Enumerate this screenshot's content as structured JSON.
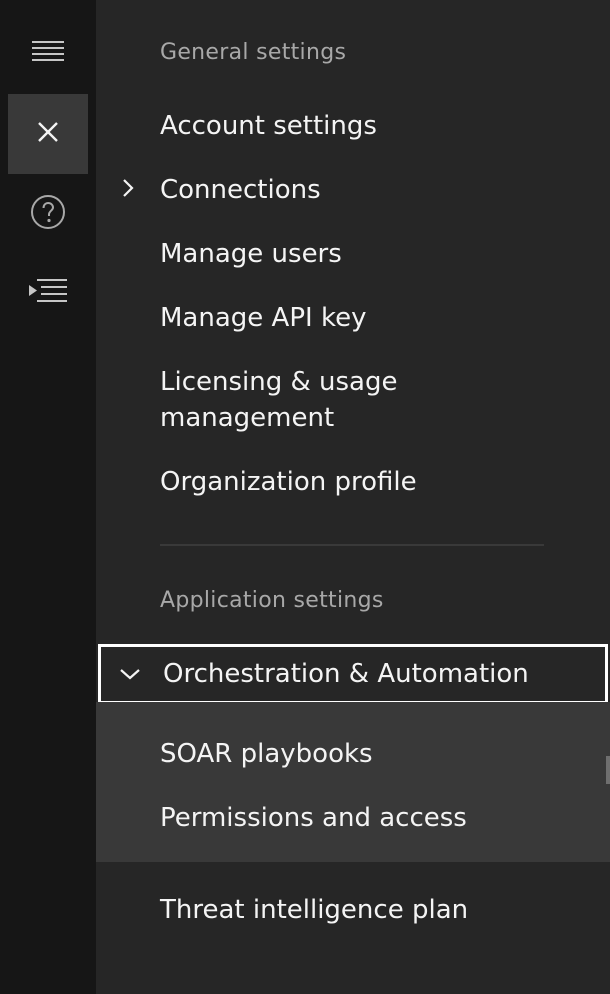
{
  "rail": {
    "items": [
      {
        "icon": "hamburger-menu-icon"
      },
      {
        "icon": "close-icon",
        "active": true
      },
      {
        "icon": "help-icon"
      },
      {
        "icon": "side-panel-toggle-icon"
      }
    ]
  },
  "general": {
    "title": "General settings",
    "items": [
      {
        "label": "Account settings"
      },
      {
        "label": "Connections"
      },
      {
        "label": "Manage users"
      },
      {
        "label": "Manage API key"
      },
      {
        "label": "Licensing & usage management"
      },
      {
        "label": "Organization profile"
      }
    ]
  },
  "application": {
    "title": "Application settings",
    "orchestration": {
      "label": "Orchestration & Automation",
      "expanded": true,
      "children": [
        {
          "label": "SOAR playbooks"
        },
        {
          "label": "Permissions and access"
        }
      ]
    },
    "threat": {
      "label": "Threat intelligence plan"
    }
  },
  "colors": {
    "rail_bg": "#161616",
    "panel_bg": "#262626",
    "active_bg": "#393939",
    "text": "#f4f4f4",
    "muted_text": "#a8a8a8",
    "focus_border": "#ffffff"
  }
}
